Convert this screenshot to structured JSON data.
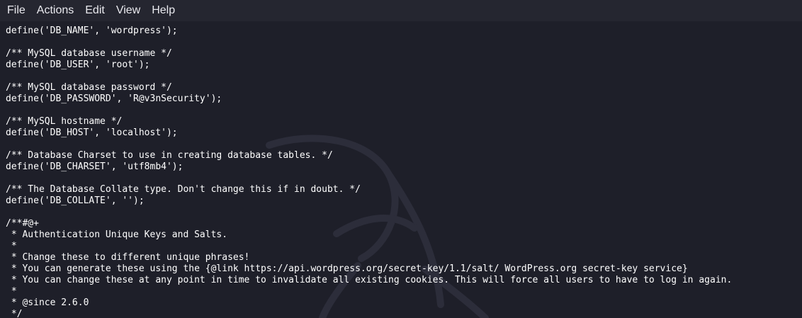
{
  "menubar": {
    "items": [
      "File",
      "Actions",
      "Edit",
      "View",
      "Help"
    ]
  },
  "terminal": {
    "lines": [
      "define('DB_NAME', 'wordpress');",
      "",
      "/** MySQL database username */",
      "define('DB_USER', 'root');",
      "",
      "/** MySQL database password */",
      "define('DB_PASSWORD', 'R@v3nSecurity');",
      "",
      "/** MySQL hostname */",
      "define('DB_HOST', 'localhost');",
      "",
      "/** Database Charset to use in creating database tables. */",
      "define('DB_CHARSET', 'utf8mb4');",
      "",
      "/** The Database Collate type. Don't change this if in doubt. */",
      "define('DB_COLLATE', '');",
      "",
      "/**#@+",
      " * Authentication Unique Keys and Salts.",
      " *",
      " * Change these to different unique phrases!",
      " * You can generate these using the {@link https://api.wordpress.org/secret-key/1.1/salt/ WordPress.org secret-key service}",
      " * You can change these at any point in time to invalidate all existing cookies. This will force all users to have to log in again.",
      " *",
      " * @since 2.6.0",
      " */"
    ]
  },
  "colors": {
    "background": "#1e1f29",
    "menubar": "#252630",
    "text": "#ffffff",
    "watermark": "#2c2d3a"
  },
  "icons": {
    "watermark": "kali-dragon-watermark-icon"
  }
}
